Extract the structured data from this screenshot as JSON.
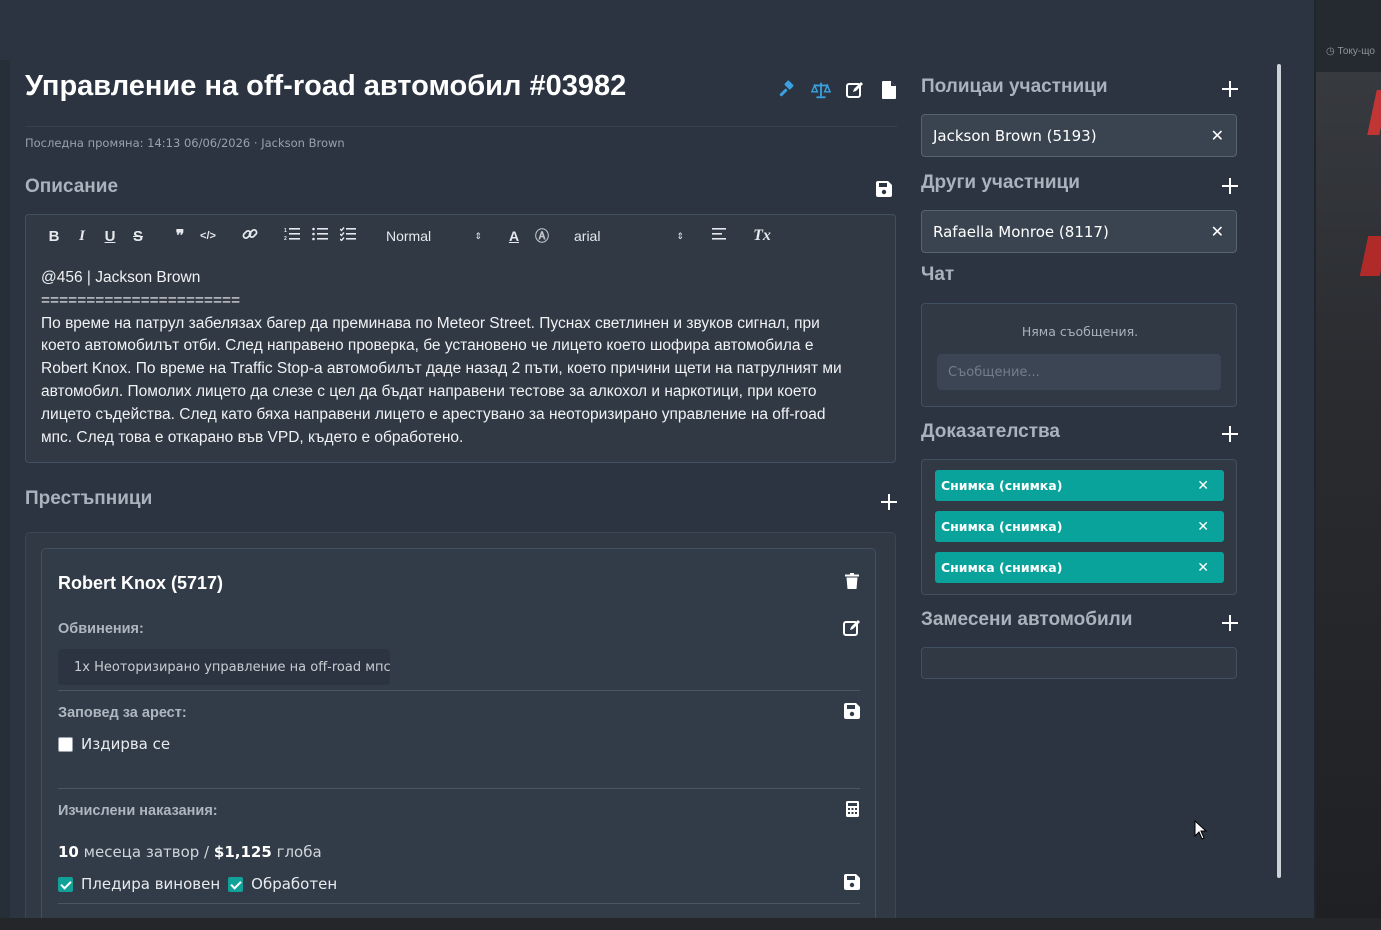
{
  "background": {
    "clock_text": "Току-що"
  },
  "header": {
    "title": "Управление на off-road автомобил #03982",
    "icons": [
      "gavel-icon",
      "balance-scale-icon",
      "edit-icon",
      "file-icon"
    ],
    "last_modified": "Последна промяна: 14:13 06/06/2026 · Jackson Brown"
  },
  "description": {
    "heading": "Описание",
    "toolbar": {
      "bold": "B",
      "italic": "I",
      "underline": "U",
      "strike": "S",
      "quote": "❞",
      "code": "</>",
      "size_select": "Normal",
      "font_select": "arial"
    },
    "lines": [
      "@456 | Jackson Brown",
      "======================",
      "По време на патрул забелязах багер да преминава по Meteor Street. Пуснах светлинен и звуков сигнал, при",
      "което автомобилът отби. След направено проверка, бе установено че лицето което шофира автомобила е",
      "Robert Knox. По време на Traffic Stop-а автомобилът даде назад 2 пъти, което причини щети на патрулният ми",
      "автомобил. Помолих лицето да слезе с цел да бъдат направени тестове за алкохол и наркотици, при което",
      "лицето съдейства. След като бяха направени лицето е арестувано за неоторизирано управление на off-road",
      "мпс. След това е откарано във VPD, където е обработено."
    ]
  },
  "criminals": {
    "heading": "Престъпници",
    "items": [
      {
        "name": "Robert Knox (5717)",
        "charges_label": "Обвинения:",
        "charges": [
          "1x Неоторизирано управление на off-road мпс"
        ],
        "warrant_label": "Заповед за арест:",
        "wanted_label": "Издирва се",
        "wanted": false,
        "penalties_label": "Изчислени наказания:",
        "months": "10",
        "months_text": "месеца затвор /",
        "fine": "$1,125",
        "fine_text": "глоба",
        "pleaded_guilty_label": "Пледира виновен",
        "pleaded_guilty": true,
        "processed_label": "Обработен",
        "processed": true
      }
    ]
  },
  "sidebar": {
    "officers": {
      "heading": "Полицаи участници",
      "items": [
        "Jackson Brown (5193)"
      ]
    },
    "others": {
      "heading": "Други участници",
      "items": [
        "Rafaella Monroe (8117)"
      ]
    },
    "chat": {
      "heading": "Чат",
      "empty_text": "Няма съобщения.",
      "input_placeholder": "Съобщение..."
    },
    "evidence": {
      "heading": "Доказателства",
      "items": [
        "Снимка (снимка)",
        "Снимка (снимка)",
        "Снимка (снимка)"
      ]
    },
    "vehicles": {
      "heading": "Замесени автомобили",
      "items": []
    }
  },
  "colors": {
    "panel": "#2b3440",
    "accent_teal": "#0aa39c",
    "icon_blue": "#3aa0e0"
  }
}
